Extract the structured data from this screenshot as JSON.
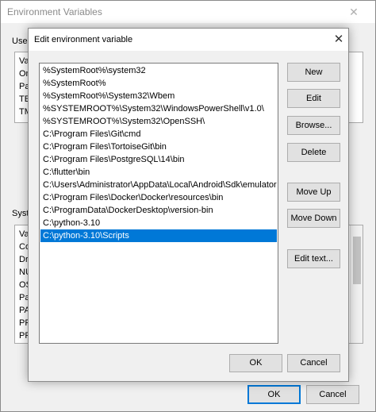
{
  "background_window": {
    "title": "Environment Variables",
    "close_glyph": "✕",
    "user_group_label": "User",
    "user_list_rows": [
      "Var",
      "On",
      "Pat",
      "TEI",
      "TM"
    ],
    "system_group_label": "Syste",
    "system_list_rows": [
      "Var",
      "Co",
      "Dri",
      "NU",
      "OS",
      "Pat",
      "PA",
      "PR",
      "PR"
    ],
    "ok_label": "OK",
    "cancel_label": "Cancel"
  },
  "dialog": {
    "title": "Edit environment variable",
    "close_glyph": "✕",
    "paths": [
      "%SystemRoot%\\system32",
      "%SystemRoot%",
      "%SystemRoot%\\System32\\Wbem",
      "%SYSTEMROOT%\\System32\\WindowsPowerShell\\v1.0\\",
      "%SYSTEMROOT%\\System32\\OpenSSH\\",
      "C:\\Program Files\\Git\\cmd",
      "C:\\Program Files\\TortoiseGit\\bin",
      "C:\\Program Files\\PostgreSQL\\14\\bin",
      "C:\\flutter\\bin",
      "C:\\Users\\Administrator\\AppData\\Local\\Android\\Sdk\\emulator",
      "C:\\Program Files\\Docker\\Docker\\resources\\bin",
      "C:\\ProgramData\\DockerDesktop\\version-bin",
      "C:\\python-3.10",
      "C:\\python-3.10\\Scripts"
    ],
    "selected_index": 13,
    "buttons": {
      "new": "New",
      "edit": "Edit",
      "browse": "Browse...",
      "delete": "Delete",
      "move_up": "Move Up",
      "move_down": "Move Down",
      "edit_text": "Edit text..."
    },
    "ok_label": "OK",
    "cancel_label": "Cancel"
  },
  "colors": {
    "selection": "#0078d7",
    "dialog_bg": "#f0f0f0",
    "button_bg": "#e1e1e1"
  }
}
